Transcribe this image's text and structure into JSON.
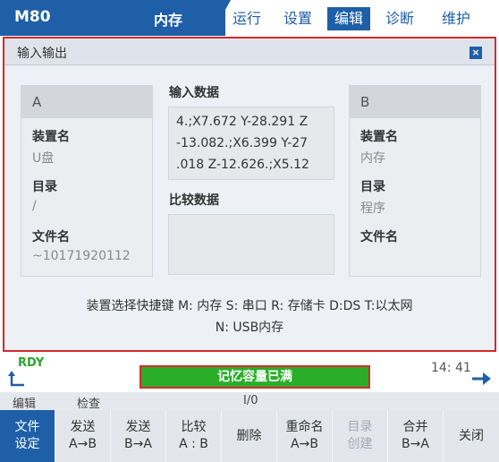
{
  "header": {
    "model": "M80",
    "mode": "内存",
    "tabs": [
      {
        "label": "运行",
        "active": false
      },
      {
        "label": "设置",
        "active": false
      },
      {
        "label": "编辑",
        "active": true
      },
      {
        "label": "诊断",
        "active": false
      },
      {
        "label": "维护",
        "active": false
      }
    ]
  },
  "dialog": {
    "title": "输入输出",
    "close_label": "×",
    "device_a": {
      "header": "A",
      "device_label": "装置名",
      "device_value": "U盘",
      "dir_label": "目录",
      "dir_value": "/",
      "file_label": "文件名",
      "file_value": "~10171920112"
    },
    "input_data": {
      "label": "输入数据",
      "lines": [
        "4.;X7.672 Y-28.291 Z",
        "-13.082.;X6.399 Y-27",
        ".018 Z-12.626.;X5.12"
      ]
    },
    "compare_data": {
      "label": "比较数据",
      "text": ""
    },
    "device_b": {
      "header": "B",
      "device_label": "装置名",
      "device_value": "内存",
      "dir_label": "目录",
      "dir_value": "程序",
      "file_label": "文件名",
      "file_value": ""
    },
    "shortcut_line1": "装置选择快捷键 M: 内存 S: 串口 R: 存储卡 D:DS T:以太网",
    "shortcut_line2": "N: USB内存"
  },
  "status": {
    "ready": "RDY",
    "message": "记忆容量已满",
    "time": "14: 41"
  },
  "subbar": {
    "items": [
      "编辑",
      "检查",
      "I/0"
    ]
  },
  "softkeys": [
    {
      "line1": "文件",
      "line2": "设定",
      "state": "active"
    },
    {
      "line1": "发送",
      "line2": "A→B",
      "state": "normal"
    },
    {
      "line1": "发送",
      "line2": "B→A",
      "state": "normal"
    },
    {
      "line1": "比较",
      "line2": "A : B",
      "state": "normal"
    },
    {
      "line1": "删除",
      "line2": "",
      "state": "normal"
    },
    {
      "line1": "重命名",
      "line2": "A→B",
      "state": "normal"
    },
    {
      "line1": "目录",
      "line2": "创建",
      "state": "disabled"
    },
    {
      "line1": "合并",
      "line2": "B→A",
      "state": "normal"
    },
    {
      "line1": "关闭",
      "line2": "",
      "state": "normal"
    }
  ],
  "colors": {
    "brand": "#1f5fa8",
    "highlight_border": "#d42a2a",
    "message_bg": "#2aae2a",
    "ready": "#2aa52a"
  }
}
